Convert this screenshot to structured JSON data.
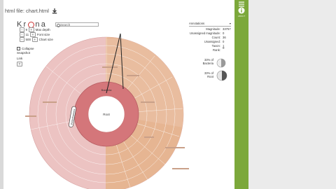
{
  "file_bar": {
    "label": "html file: chart.html",
    "download_icon": "download-icon"
  },
  "viewer": {
    "logo": {
      "prefix": "Kr",
      "suffix": "na"
    },
    "controls": {
      "max_depth_label": "Max depth",
      "max_depth_value": "9",
      "font_size_label": "Font size",
      "font_size_value": "11",
      "chart_size_label": "Chart size",
      "chart_size_value": "500",
      "search_placeholder": "Search",
      "collapse_label": "Collapse",
      "snapshot_label": "Snapshot",
      "link_label": "Link",
      "help_label": "?"
    },
    "info_panel": {
      "annotations_label": "Annotations",
      "rows": [
        {
          "label": "Magnitude:",
          "value": "33757"
        },
        {
          "label": "Unassigned magnitude:",
          "value": "0"
        },
        {
          "label": "Count:",
          "value": "36"
        },
        {
          "label": "Unassigned:",
          "value": "0"
        },
        {
          "label": "Taxon:",
          "value": "1"
        },
        {
          "label": "Rank:",
          "value": ""
        }
      ],
      "pie_keys": [
        {
          "label": "33% of Bacteria"
        },
        {
          "label": "33% of Root"
        }
      ]
    },
    "chart_labels": {
      "root": "Root",
      "bacteria": "Bacteria",
      "proteobacteria": "Proteobacteria"
    }
  },
  "side_panel": {
    "top_label": "",
    "icons": [
      {
        "name": "list-icon",
        "label": ""
      },
      {
        "name": "info-icon",
        "label": "ABOUT"
      }
    ]
  },
  "colors": {
    "green_panel": "#7ca83b",
    "gray_panel": "#ebebeb",
    "bacteria_ring": "#d4767a",
    "outer_pink": "#ecc3c2",
    "tan": "#e3b38f"
  }
}
